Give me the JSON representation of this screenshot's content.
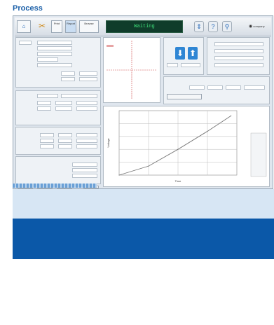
{
  "app": {
    "title": "Process"
  },
  "toolbar": {
    "status_text": "Waiting",
    "logo_text": "company",
    "btn1": "Print",
    "btn2": "Report",
    "btn3": "Browse"
  },
  "chart_data": {
    "type": "line",
    "title": "",
    "xlabel": "Time",
    "ylabel": "Voltage",
    "x": [
      0,
      100,
      200,
      300,
      380
    ],
    "y": [
      0,
      35,
      100,
      170,
      230
    ],
    "xlim": [
      0,
      400
    ],
    "ylim": [
      0,
      250
    ],
    "grid": true,
    "legend_position": "right"
  },
  "colors": {
    "title": "#1a5fa8",
    "status_bg": "#0f3c2a",
    "status_text": "#3ee07a",
    "banner": "#0b58a8",
    "accent_arrow": "#2f86d4"
  }
}
